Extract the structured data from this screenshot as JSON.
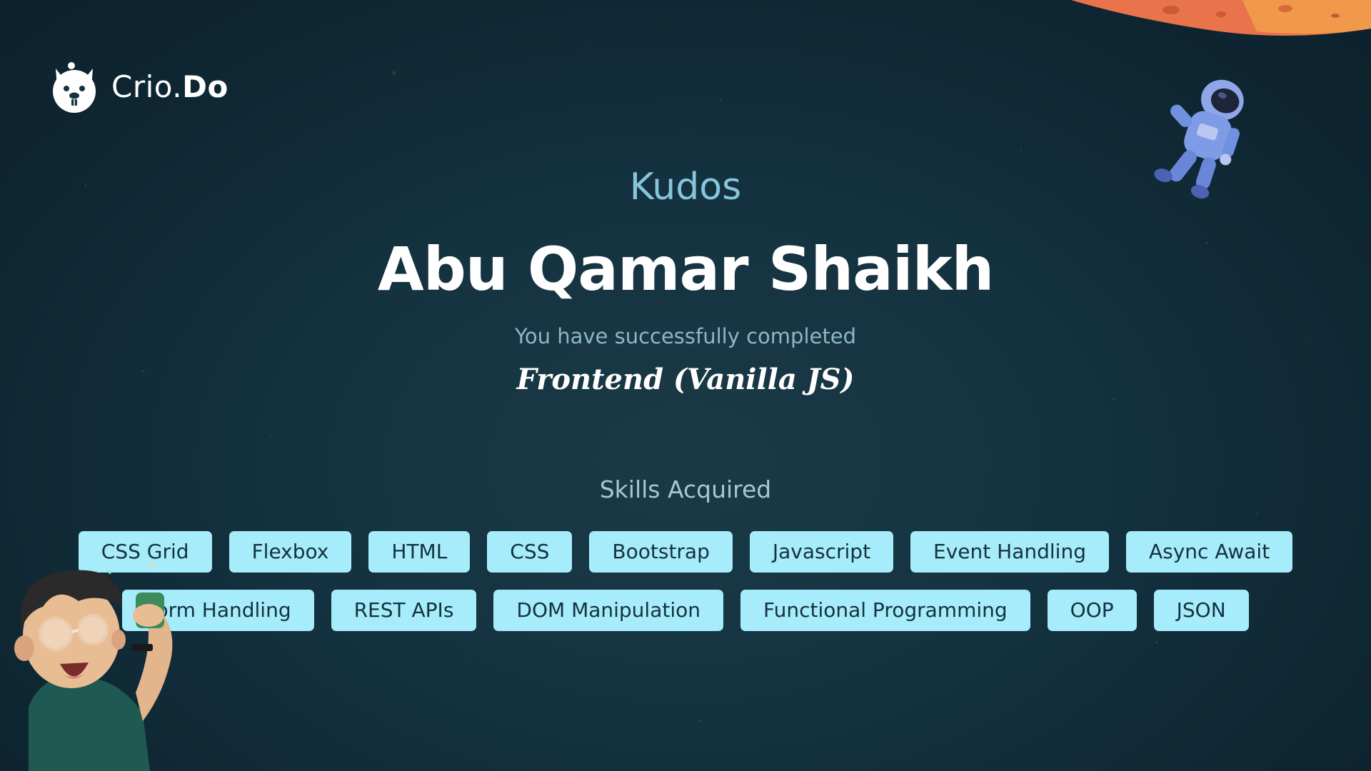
{
  "logo": {
    "name_regular": "Crio.",
    "name_bold": "Do",
    "icon": "beaver-logo-icon"
  },
  "certificate": {
    "heading": "Kudos",
    "recipient": "Abu Qamar Shaikh",
    "message": "You have successfully completed",
    "course": "Frontend (Vanilla JS)"
  },
  "skills": {
    "title": "Skills Acquired",
    "row1": [
      "CSS Grid",
      "Flexbox",
      "HTML",
      "CSS",
      "Bootstrap",
      "Javascript",
      "Event Handling",
      "Async Await"
    ],
    "row2": [
      "Form Handling",
      "REST APIs",
      "DOM Manipulation",
      "Functional Programming",
      "OOP",
      "JSON"
    ]
  },
  "decorations": {
    "planet": "planet-illustration",
    "astronaut": "astronaut-illustration",
    "character": "celebrating-character-illustration"
  },
  "colors": {
    "background": "#143240",
    "accent": "#86c5dd",
    "chip_bg": "#a6ecfb",
    "chip_text": "#14323d",
    "planet": "#e9734a"
  }
}
